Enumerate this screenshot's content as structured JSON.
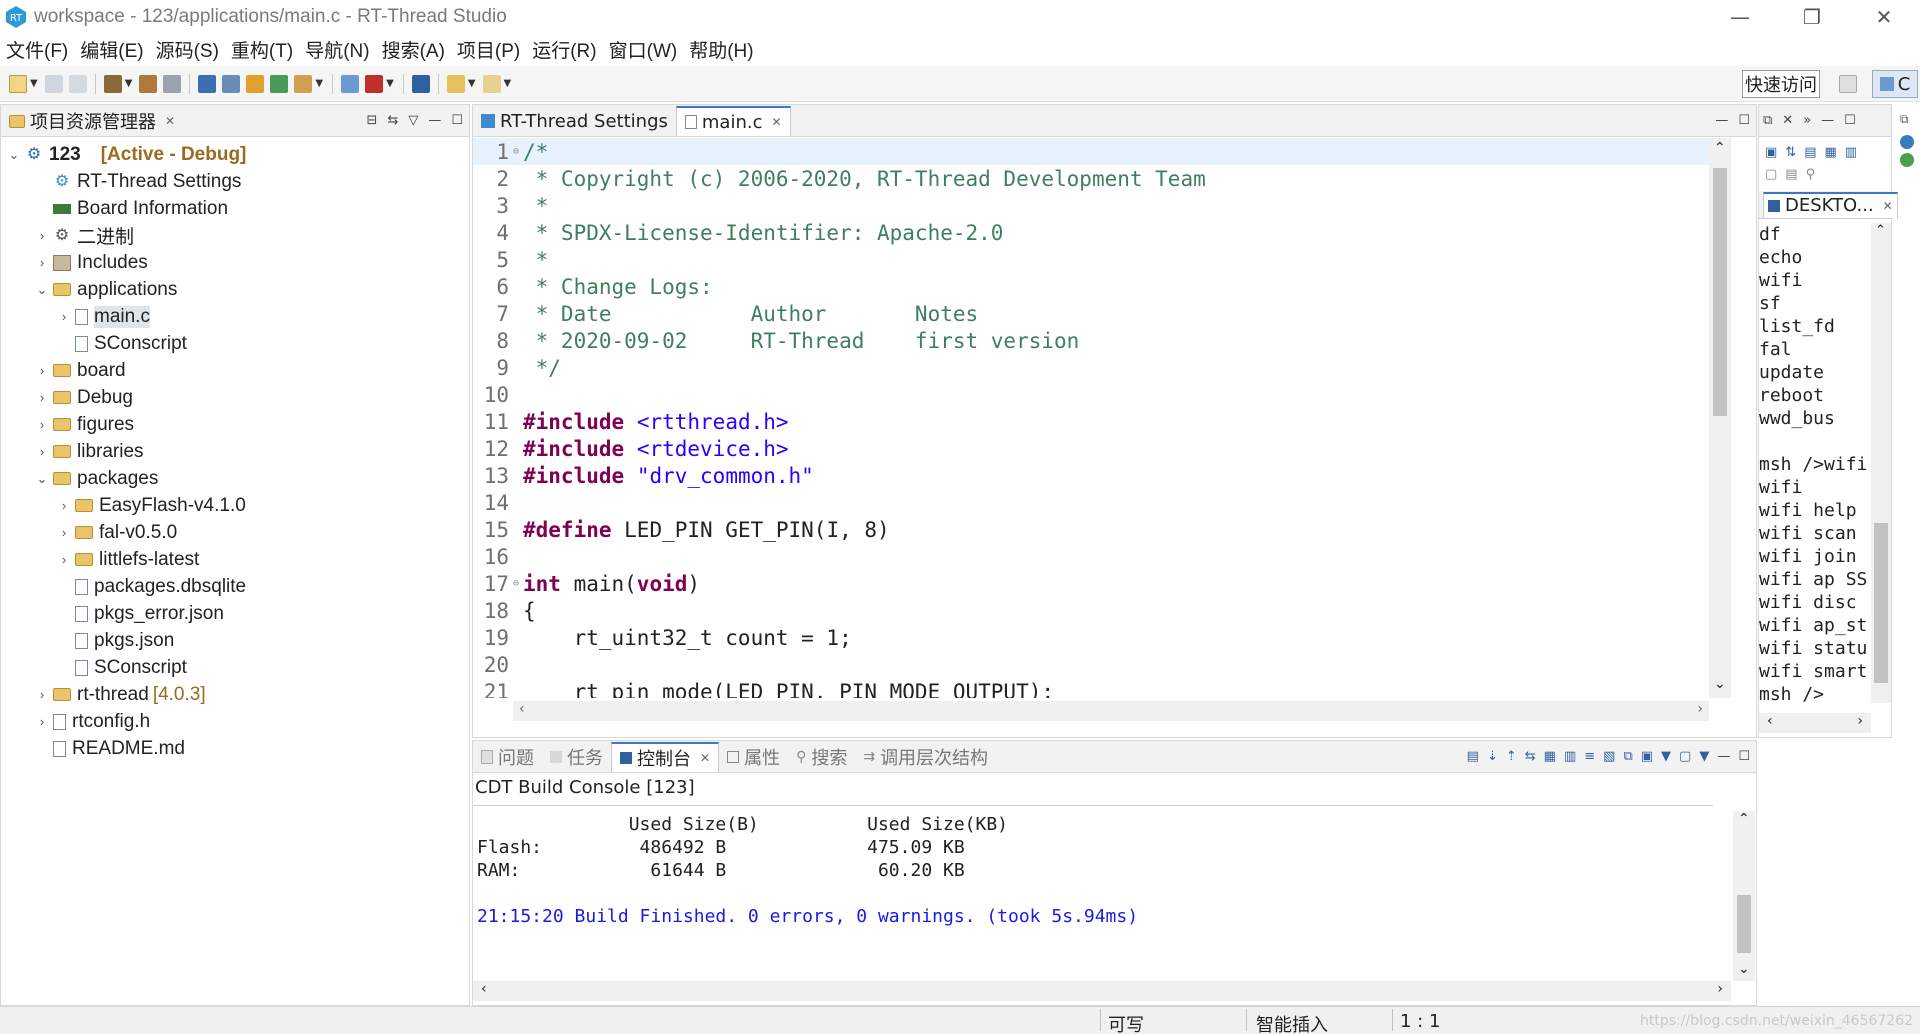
{
  "window": {
    "title": "workspace - 123/applications/main.c - RT-Thread Studio"
  },
  "menu": [
    "文件(F)",
    "编辑(E)",
    "源码(S)",
    "重构(T)",
    "导航(N)",
    "搜索(A)",
    "项目(P)",
    "运行(R)",
    "窗口(W)",
    "帮助(H)"
  ],
  "toolbar": {
    "quick_access": "快速访问",
    "perspective": "C"
  },
  "explorer": {
    "tab": "项目资源管理器",
    "project": "123",
    "project_status": "[Active - Debug]",
    "items": {
      "rt_settings": "RT-Thread Settings",
      "board_info": "Board Information",
      "binaries": "二进制",
      "includes": "Includes",
      "applications": "applications",
      "main_c": "main.c",
      "sconscript_app": "SConscript",
      "board": "board",
      "debug": "Debug",
      "figures": "figures",
      "libraries": "libraries",
      "packages": "packages",
      "easyflash": "EasyFlash-v4.1.0",
      "fal": "fal-v0.5.0",
      "littlefs": "littlefs-latest",
      "pkg_db": "packages.dbsqlite",
      "pkgs_error": "pkgs_error.json",
      "pkgs": "pkgs.json",
      "sconscript_pkg": "SConscript",
      "rt_thread": "rt-thread",
      "rt_thread_ver": "[4.0.3]",
      "rtconfig": "rtconfig.h",
      "readme": "README.md"
    }
  },
  "editor": {
    "tabs": [
      "RT-Thread Settings",
      "main.c"
    ],
    "lines": [
      {
        "n": "1",
        "parts": [
          [
            "cm",
            "/*"
          ]
        ]
      },
      {
        "n": "2",
        "parts": [
          [
            "cm",
            " * Copyright (c) 2006-2020, RT-Thread Development Team"
          ]
        ]
      },
      {
        "n": "3",
        "parts": [
          [
            "cm",
            " *"
          ]
        ]
      },
      {
        "n": "4",
        "parts": [
          [
            "cm",
            " * SPDX-License-Identifier: Apache-2.0"
          ]
        ]
      },
      {
        "n": "5",
        "parts": [
          [
            "cm",
            " *"
          ]
        ]
      },
      {
        "n": "6",
        "parts": [
          [
            "cm",
            " * Change Logs:"
          ]
        ]
      },
      {
        "n": "7",
        "parts": [
          [
            "cm",
            " * Date           Author       Notes"
          ]
        ]
      },
      {
        "n": "8",
        "parts": [
          [
            "cm",
            " * 2020-09-02     RT-Thread    first version"
          ]
        ]
      },
      {
        "n": "9",
        "parts": [
          [
            "cm",
            " */"
          ]
        ]
      },
      {
        "n": "10",
        "parts": []
      },
      {
        "n": "11",
        "parts": [
          [
            "kw",
            "#include"
          ],
          [
            "",
            " "
          ],
          [
            "str",
            "<rtthread.h>"
          ]
        ]
      },
      {
        "n": "12",
        "parts": [
          [
            "kw",
            "#include"
          ],
          [
            "",
            " "
          ],
          [
            "str",
            "<rtdevice.h>"
          ]
        ]
      },
      {
        "n": "13",
        "parts": [
          [
            "kw",
            "#include"
          ],
          [
            "",
            " "
          ],
          [
            "str",
            "\"drv_common.h\""
          ]
        ]
      },
      {
        "n": "14",
        "parts": []
      },
      {
        "n": "15",
        "parts": [
          [
            "kw",
            "#define"
          ],
          [
            "",
            " LED_PIN GET_PIN(I, 8)"
          ]
        ]
      },
      {
        "n": "16",
        "parts": []
      },
      {
        "n": "17",
        "parts": [
          [
            "kw",
            "int"
          ],
          [
            "",
            " main("
          ],
          [
            "kw",
            "void"
          ],
          [
            "",
            ")"
          ]
        ]
      },
      {
        "n": "18",
        "parts": [
          [
            "",
            "{"
          ]
        ]
      },
      {
        "n": "19",
        "parts": [
          [
            "",
            "    rt_uint32_t count = 1;"
          ]
        ]
      },
      {
        "n": "20",
        "parts": []
      },
      {
        "n": "21",
        "parts": [
          [
            "",
            "    rt_pin_mode(LED_PIN, PIN_MODE_OUTPUT);"
          ]
        ]
      }
    ]
  },
  "terminal": {
    "tab": "DESKTO...",
    "lines": [
      "df",
      "echo",
      "wifi",
      "sf",
      "list_fd",
      "fal",
      "update",
      "reboot",
      "wwd_bus",
      "",
      "msh />wifi",
      "wifi",
      "wifi help",
      "wifi scan",
      "wifi join",
      "wifi ap SS",
      "wifi disc",
      "wifi ap_st",
      "wifi statu",
      "wifi smart",
      "msh />"
    ]
  },
  "console": {
    "tabs": [
      "问题",
      "任务",
      "控制台",
      "属性",
      "搜索",
      "调用层次结构"
    ],
    "title": "CDT Build Console [123]",
    "lines": [
      "              Used Size(B)          Used Size(KB)",
      "Flash:         486492 B             475.09 KB",
      "RAM:            61644 B              60.20 KB",
      ""
    ],
    "finish": "21:15:20 Build Finished. 0 errors, 0 warnings. (took 5s.94ms)"
  },
  "status": {
    "writable": "可写",
    "insert_mode": "智能插入",
    "position": "1 : 1",
    "watermark": "https://blog.csdn.net/weixin_46567262"
  }
}
